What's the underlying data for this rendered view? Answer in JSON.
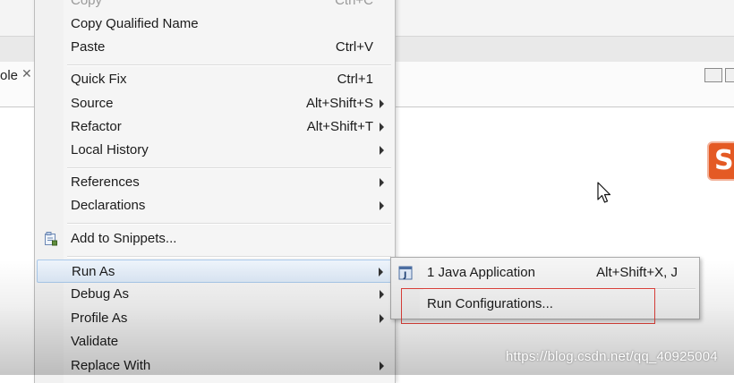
{
  "background": {
    "tab_label": "ole",
    "close_glyph": "✕",
    "watermark": "https://blog.csdn.net/qq_40925004",
    "logo_glyph": "S"
  },
  "context_menu": {
    "items": [
      {
        "label": "Copy",
        "accel": "Ctrl+C",
        "faded": true
      },
      {
        "label": "Copy Qualified Name",
        "accel": ""
      },
      {
        "label": "Paste",
        "accel": "Ctrl+V"
      },
      {
        "label": "Quick Fix",
        "accel": "Ctrl+1"
      },
      {
        "label": "Source",
        "accel": "Alt+Shift+S"
      },
      {
        "label": "Refactor",
        "accel": "Alt+Shift+T"
      },
      {
        "label": "Local History",
        "accel": ""
      },
      {
        "label": "References",
        "accel": ""
      },
      {
        "label": "Declarations",
        "accel": ""
      },
      {
        "label": "Add to Snippets...",
        "accel": ""
      },
      {
        "label": "Run As",
        "accel": ""
      },
      {
        "label": "Debug As",
        "accel": ""
      },
      {
        "label": "Profile As",
        "accel": ""
      },
      {
        "label": "Validate",
        "accel": ""
      },
      {
        "label": "Replace With",
        "accel": ""
      }
    ]
  },
  "run_as_submenu": {
    "items": [
      {
        "label": "1 Java Application",
        "accel": "Alt+Shift+X, J"
      },
      {
        "label": "Run Configurations...",
        "accel": ""
      }
    ]
  },
  "colors": {
    "highlight_border": "#a8c8ea",
    "annotation_red": "#e0403a",
    "logo_orange": "#e45a24"
  }
}
